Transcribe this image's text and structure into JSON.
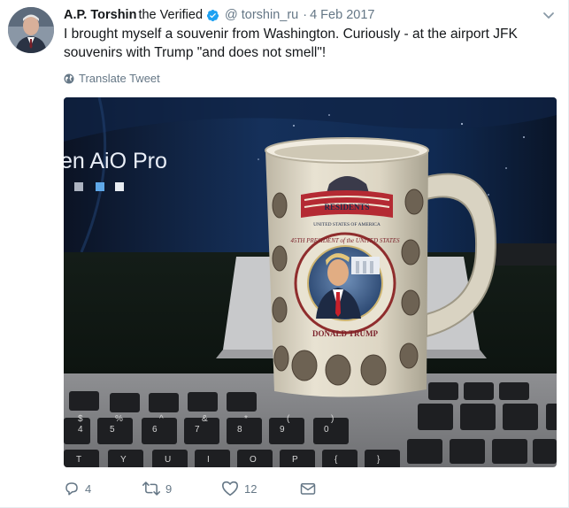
{
  "tweet": {
    "author": {
      "fullname": "A.P. Torshin",
      "name_suffix": "the Verified",
      "username": "@ torshin_ru",
      "avatar_icon": "avatar-photo",
      "verified_icon": "verified-badge-icon"
    },
    "separator": "·",
    "timestamp": "4 Feb 2017",
    "text": "I brought myself a souvenir from Washington. Curiously - at the airport JFK souvenirs with Trump \"and does not smell\"!",
    "translate_label": "Translate Tweet",
    "media": {
      "screen_text": "en AiO Pro",
      "mug_text_top": "RESIDENTS",
      "mug_text_ring": "45TH PRESIDENT of the UNITED STATES",
      "mug_text_bottom": "DONALD TRUMP",
      "mug_small": "UNITED STATES OF AMERICA",
      "keyboard_keys": [
        "$",
        "%",
        "^",
        "&",
        "*",
        "(",
        ")",
        "4",
        "5",
        "6",
        "7",
        "8",
        "9",
        "0",
        "T",
        "Y",
        "U",
        "I",
        "O",
        "P",
        "{",
        "}"
      ]
    },
    "actions": {
      "reply_count": "4",
      "retweet_count": "9",
      "like_count": "12"
    },
    "colors": {
      "verified_blue": "#1da1f2",
      "muted_gray": "#657786",
      "text_dark": "#14171a"
    }
  }
}
